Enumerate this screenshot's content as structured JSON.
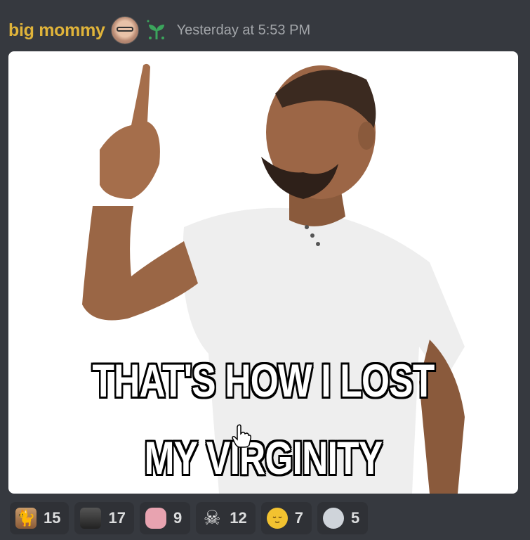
{
  "message": {
    "author": "big mommy",
    "timestamp": "Yesterday at 5:53 PM",
    "author_color": "#e0b43a"
  },
  "meme": {
    "caption_line1": "THAT'S HOW I LOST",
    "caption_line2": "MY VIRGINITY"
  },
  "reactions": [
    {
      "icon": "cat-emoji-icon",
      "count": "15"
    },
    {
      "icon": "dark-image-emoji-icon",
      "count": "17"
    },
    {
      "icon": "pig-emoji-icon",
      "count": "9"
    },
    {
      "icon": "skull-icon",
      "count": "12"
    },
    {
      "icon": "relieved-face-icon",
      "count": "7"
    },
    {
      "icon": "hand-emoji-icon",
      "count": "5"
    }
  ]
}
